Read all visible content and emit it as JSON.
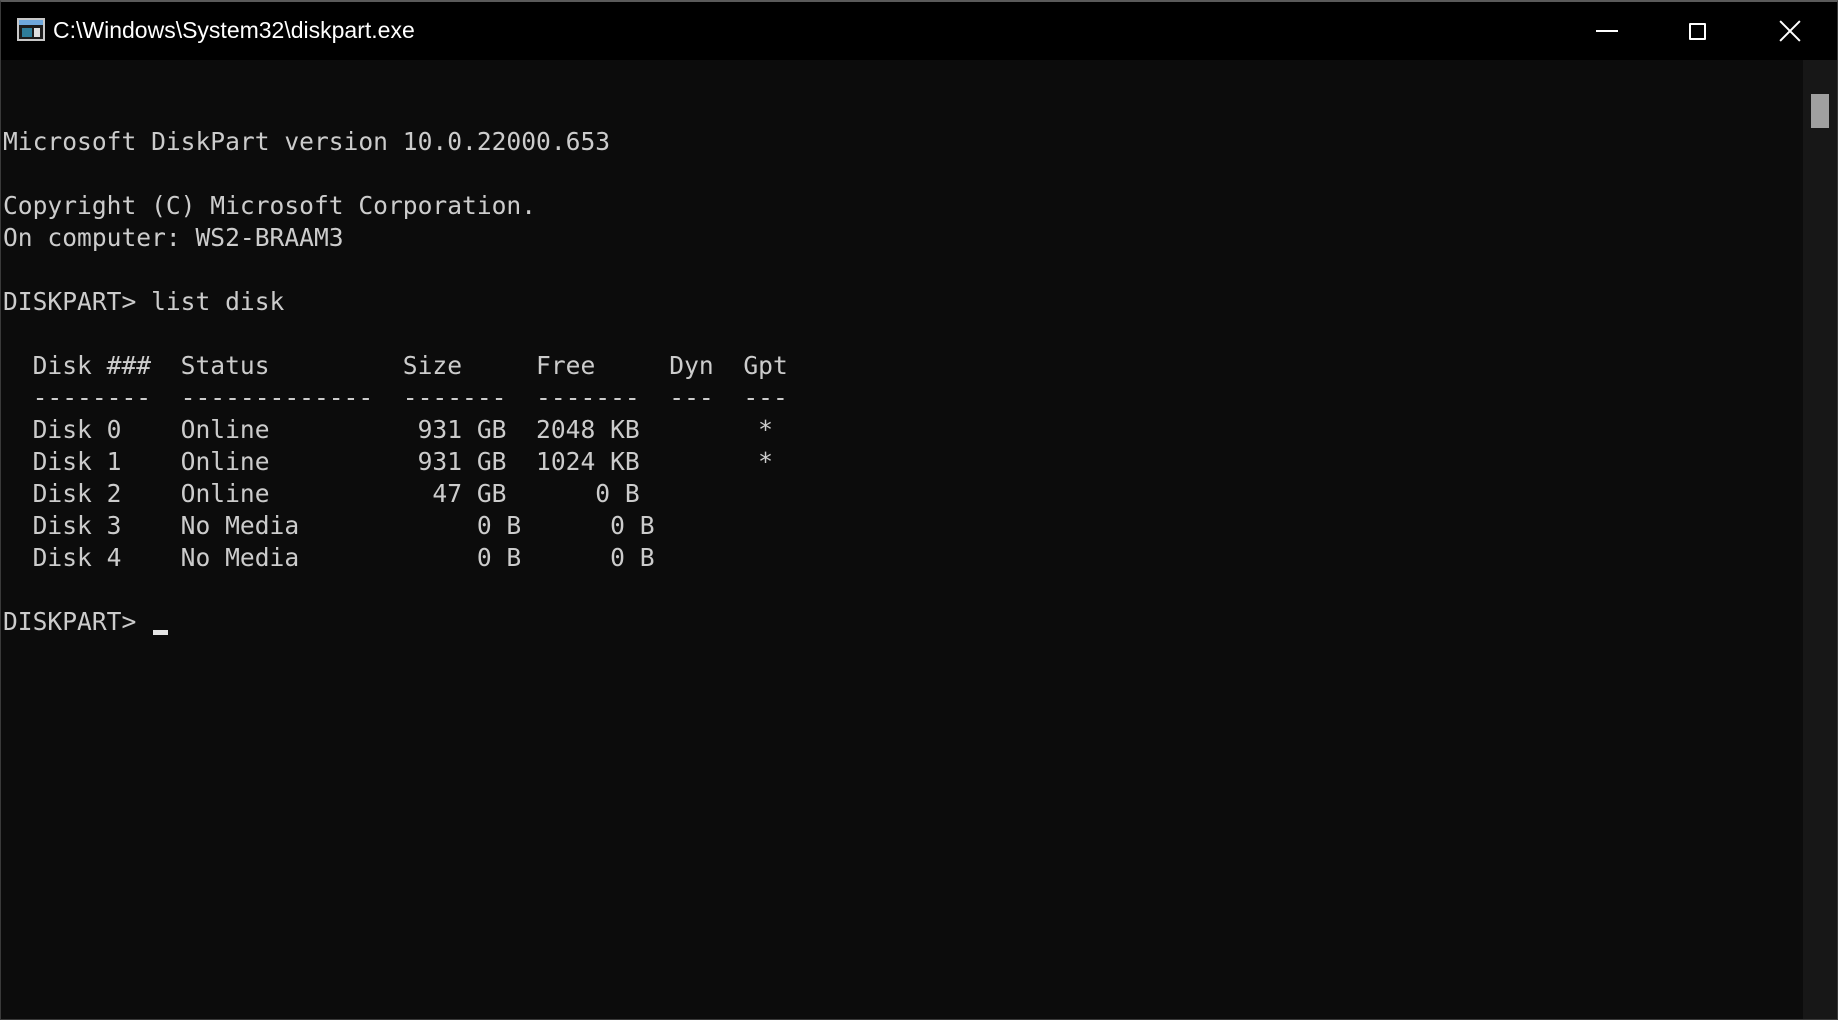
{
  "window": {
    "title": "C:\\Windows\\System32\\diskpart.exe",
    "app_icon": "console-window-icon",
    "controls": {
      "minimize": "minimize-icon",
      "maximize": "maximize-icon",
      "close": "close-icon"
    }
  },
  "console": {
    "lines": [
      "",
      "Microsoft DiskPart version 10.0.22000.653",
      "",
      "Copyright (C) Microsoft Corporation.",
      "On computer: WS2-BRAAM3",
      "",
      "DISKPART> list disk",
      "",
      "  Disk ###  Status         Size     Free     Dyn  Gpt",
      "  --------  -------------  -------  -------  ---  ---",
      "  Disk 0    Online          931 GB  2048 KB        *",
      "  Disk 1    Online          931 GB  1024 KB        *",
      "  Disk 2    Online           47 GB      0 B",
      "  Disk 3    No Media            0 B      0 B",
      "  Disk 4    No Media            0 B      0 B",
      ""
    ],
    "prompt": "DISKPART> ",
    "input_value": ""
  },
  "colors": {
    "background": "#0c0c0c",
    "foreground": "#cccccc",
    "titlebar": "#000000"
  }
}
